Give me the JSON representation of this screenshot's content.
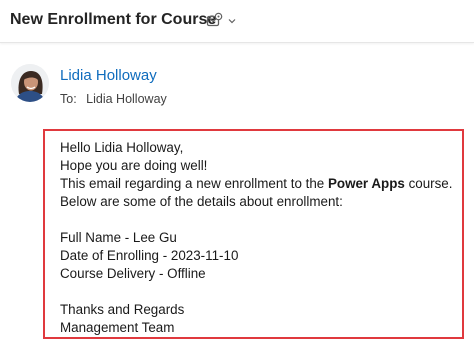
{
  "header": {
    "subject": "New Enrollment for Course",
    "actions_icon": "mail-settings-icon",
    "chevron_icon": "chevron-down-icon"
  },
  "sender": {
    "name": "Lidia Holloway",
    "avatar_icon": "avatar-photo",
    "to_label": "To:",
    "to_value": "Lidia Holloway"
  },
  "body": {
    "greeting": "Hello Lidia Holloway,",
    "line2": "Hope you are doing well!",
    "line3_prefix": "This email regarding a new enrollment to the ",
    "line3_course": "Power Apps",
    "line3_suffix": " course.",
    "line4": "Below are some of the details about enrollment:",
    "full_name": "Full Name - Lee Gu",
    "date_of_enrolling": "Date of Enrolling - 2023-11-10",
    "course_delivery": "Course Delivery -  Offline",
    "closing": "Thanks and Regards",
    "signature": "Management Team"
  },
  "colors": {
    "sender_link": "#0f6cbd",
    "highlight_border": "#e0393e",
    "text": "#242424"
  }
}
